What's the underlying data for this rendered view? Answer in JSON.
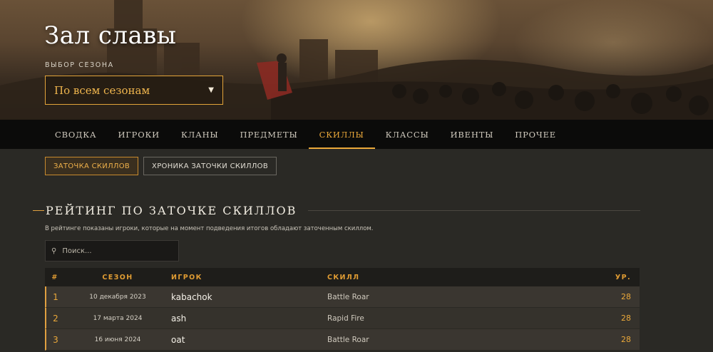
{
  "hero": {
    "title": "Зал славы",
    "season_label": "ВЫБОР СЕЗОНА",
    "season_selected": "По всем сезонам"
  },
  "nav": {
    "items": [
      {
        "label": "СВОДКА"
      },
      {
        "label": "ИГРОКИ"
      },
      {
        "label": "КЛАНЫ"
      },
      {
        "label": "ПРЕДМЕТЫ"
      },
      {
        "label": "СКИЛЛЫ",
        "active": true
      },
      {
        "label": "КЛАССЫ"
      },
      {
        "label": "ИВЕНТЫ"
      },
      {
        "label": "ПРОЧЕЕ"
      }
    ]
  },
  "subtabs": [
    {
      "label": "ЗАТОЧКА СКИЛЛОВ",
      "active": true
    },
    {
      "label": "ХРОНИКА ЗАТОЧКИ СКИЛЛОВ"
    }
  ],
  "section": {
    "title": "РЕЙТИНГ ПО ЗАТОЧКЕ СКИЛЛОВ",
    "description": "В рейтинге показаны игроки, которые на момент подведения итогов обладают заточенным скиллом."
  },
  "search": {
    "placeholder": "Поиск...",
    "icon": "search-icon"
  },
  "table": {
    "headers": {
      "num": "#",
      "season": "СЕЗОН",
      "player": "ИГРОК",
      "skill": "СКИЛЛ",
      "level": "УР."
    },
    "rows": [
      {
        "num": "1",
        "season": "10 декабря 2023",
        "player": "kabachok",
        "skill": "Battle Roar",
        "level": "28"
      },
      {
        "num": "2",
        "season": "17 марта 2024",
        "player": "ash",
        "skill": "Rapid Fire",
        "level": "28"
      },
      {
        "num": "3",
        "season": "16 июня 2024",
        "player": "oat",
        "skill": "Battle Roar",
        "level": "28"
      }
    ]
  },
  "colors": {
    "accent": "#eaa83a",
    "nav_bg": "#0b0b0a",
    "page_bg": "#2a2925"
  }
}
